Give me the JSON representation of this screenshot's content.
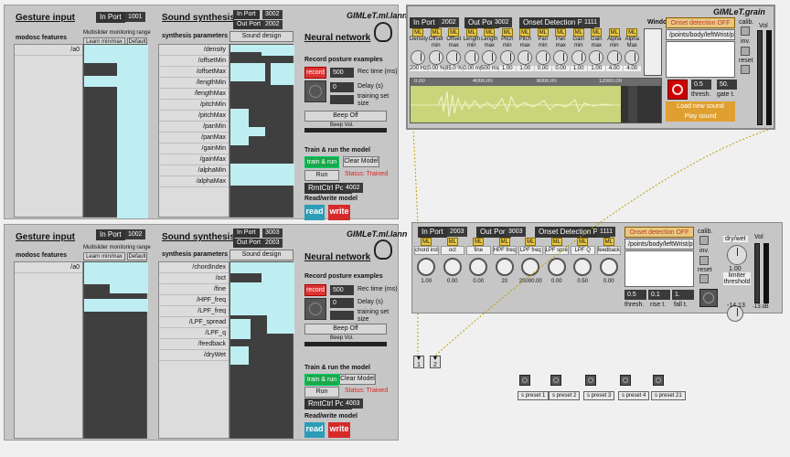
{
  "p1": {
    "gesture_title": "Gesture input",
    "in_port_label": "In Port",
    "in_port": "1001",
    "features_label": "modosc features",
    "feature_0": "/a0",
    "ms_range_label": "Multislider monitoring range",
    "learn_btn": "Learn min/max",
    "default_btn": "Default",
    "synth_title": "Sound synthesis",
    "synth_in_label": "In Port",
    "synth_in": "3002",
    "synth_out_label": "Out Port",
    "synth_out": "2002",
    "synth_params_label": "synthesis parameters",
    "sound_design": "Sound design",
    "params": [
      "/density",
      "/offsetMin",
      "/offsetMax",
      "/lengthMin",
      "/lengthMax",
      "/pitchMin",
      "/pitchMax",
      "/panMin",
      "/panMax",
      "/gainMin",
      "/gainMax",
      "/alphaMin",
      "/alphaMax"
    ],
    "app_title": "GIMLeT.ml.lann",
    "nn_title": "Neural network",
    "rec_title": "Record posture examples",
    "record_btn": "record",
    "rec_time": "500",
    "rec_time_label": "Rec time (ms)",
    "delay": "0",
    "delay_label": "Delay (s)",
    "training_label": "training set size",
    "beep_off": "Beep Off",
    "beep_vol": "Beep Vol.",
    "train_title": "Train & run the model",
    "train_btn": "train & run",
    "clear_btn": "Clear Model",
    "run_btn": "Run",
    "status": "Status: Trained",
    "rmt_label": "RmtCtrl Port",
    "rmt_port": "4002",
    "rw_label": "Read/write model",
    "read_btn": "read",
    "write_btn": "write"
  },
  "p2": {
    "gesture_title": "Gesture input",
    "in_port_label": "In Port",
    "in_port": "1002",
    "features_label": "modosc features",
    "feature_0": "/a0",
    "ms_range_label": "Multislider monitoring range",
    "learn_btn": "Learn min/max",
    "default_btn": "Default",
    "synth_title": "Sound synthesis",
    "synth_in_label": "In Port",
    "synth_in": "3003",
    "synth_out_label": "Out Port",
    "synth_out": "2003",
    "synth_params_label": "synthesis parameters",
    "sound_design": "Sound design",
    "params": [
      "/chordIndex",
      "/oct",
      "/fine",
      "/HPF_freq",
      "/LPF_freq",
      "/LPF_spread",
      "/LPF_q",
      "/feedback",
      "/dryWet"
    ],
    "app_title": "GIMLeT.ml.lann",
    "nn_title": "Neural network",
    "rec_title": "Record posture examples",
    "record_btn": "record",
    "rec_time": "500",
    "rec_time_label": "Rec time (ms)",
    "delay": "0",
    "delay_label": "Delay (s)",
    "training_label": "training set size",
    "beep_off": "Beep Off",
    "beep_vol": "Beep Vol.",
    "train_title": "Train & run the model",
    "train_btn": "train & run",
    "clear_btn": "Clear Model",
    "run_btn": "Run",
    "status": "Status: Trained",
    "rmt_label": "RmtCtrl Port",
    "rmt_port": "4003",
    "rw_label": "Read/write model",
    "read_btn": "read",
    "write_btn": "write"
  },
  "grain": {
    "title": "GIMLeT.grain",
    "in_label": "In Port",
    "in_port": "2002",
    "out_label": "Out Port",
    "out_port": "3002",
    "onset_label": "Onset Detection Port",
    "onset_port": "1111",
    "window_label": "Window shape",
    "onset_off": "Onset detection OFF",
    "path": "/points/body/leftWrist/p...",
    "calib": "calib.",
    "inv": "inv.",
    "reset": "reset",
    "vol": "Vol",
    "params": [
      {
        "n": "Density",
        "v": "200 Hz"
      },
      {
        "n": "Offset min",
        "v": "0.00 %"
      },
      {
        "n": "Offset max",
        "v": "85.0 %"
      },
      {
        "n": "Length min",
        "v": "0.00 ms"
      },
      {
        "n": "Length max",
        "v": "500 ms"
      },
      {
        "n": "Pitch min",
        "v": "1.00"
      },
      {
        "n": "Pitch max",
        "v": "1.00"
      },
      {
        "n": "Pan min",
        "v": "0.00"
      },
      {
        "n": "Pan max",
        "v": "0.00"
      },
      {
        "n": "Gain min",
        "v": "1.00"
      },
      {
        "n": "Gain max",
        "v": "1.00"
      },
      {
        "n": "Alpha min",
        "v": "4.00"
      },
      {
        "n": "Alpha Max",
        "v": "4.00"
      }
    ],
    "ticks": [
      "0.00",
      "4000.00",
      "8000.00",
      "12000.00"
    ],
    "thresh": "0.5",
    "thresh_label": "thresh.",
    "gate": "50.",
    "gate_label": "gate t.",
    "load_btn": "Load new sound",
    "play_btn": "Play sound"
  },
  "fx": {
    "in_label": "In Port",
    "in_port": "2003",
    "out_label": "Out Port",
    "out_port": "3003",
    "onset_label": "Onset Detection Port",
    "onset_port": "1111",
    "onset_off": "Onset detection OFF",
    "path": "/points/body/leftWrist/p...",
    "calib": "calib.",
    "inv": "inv.",
    "reset": "reset",
    "vol": "Vol",
    "params": [
      {
        "n": "chord index",
        "v": "1.00"
      },
      {
        "n": "oct",
        "v": "0.00"
      },
      {
        "n": "fine",
        "v": "0.00"
      },
      {
        "n": "HPF freq",
        "v": "20"
      },
      {
        "n": "LPF freq",
        "v": "20000.00"
      },
      {
        "n": "LPF spread",
        "v": "0.00"
      },
      {
        "n": "LPF Q",
        "v": "0.50"
      },
      {
        "n": "feedback",
        "v": "0.00"
      }
    ],
    "drywet_label": "dry/wet",
    "drywet": "1.00",
    "limiter_label": "limiter threshold",
    "limiter": "-14.13",
    "db": "-13 dB",
    "thresh": "0.5",
    "thresh_label": "thresh.",
    "rise": "0.1",
    "rise_label": "rise t.",
    "fall": "1.",
    "fall_label": "fall t."
  },
  "outlets": [
    "1",
    "2"
  ],
  "presets": [
    "s preset 1",
    "s preset 2",
    "s preset 3",
    "s preset 4",
    "s preset 21"
  ]
}
